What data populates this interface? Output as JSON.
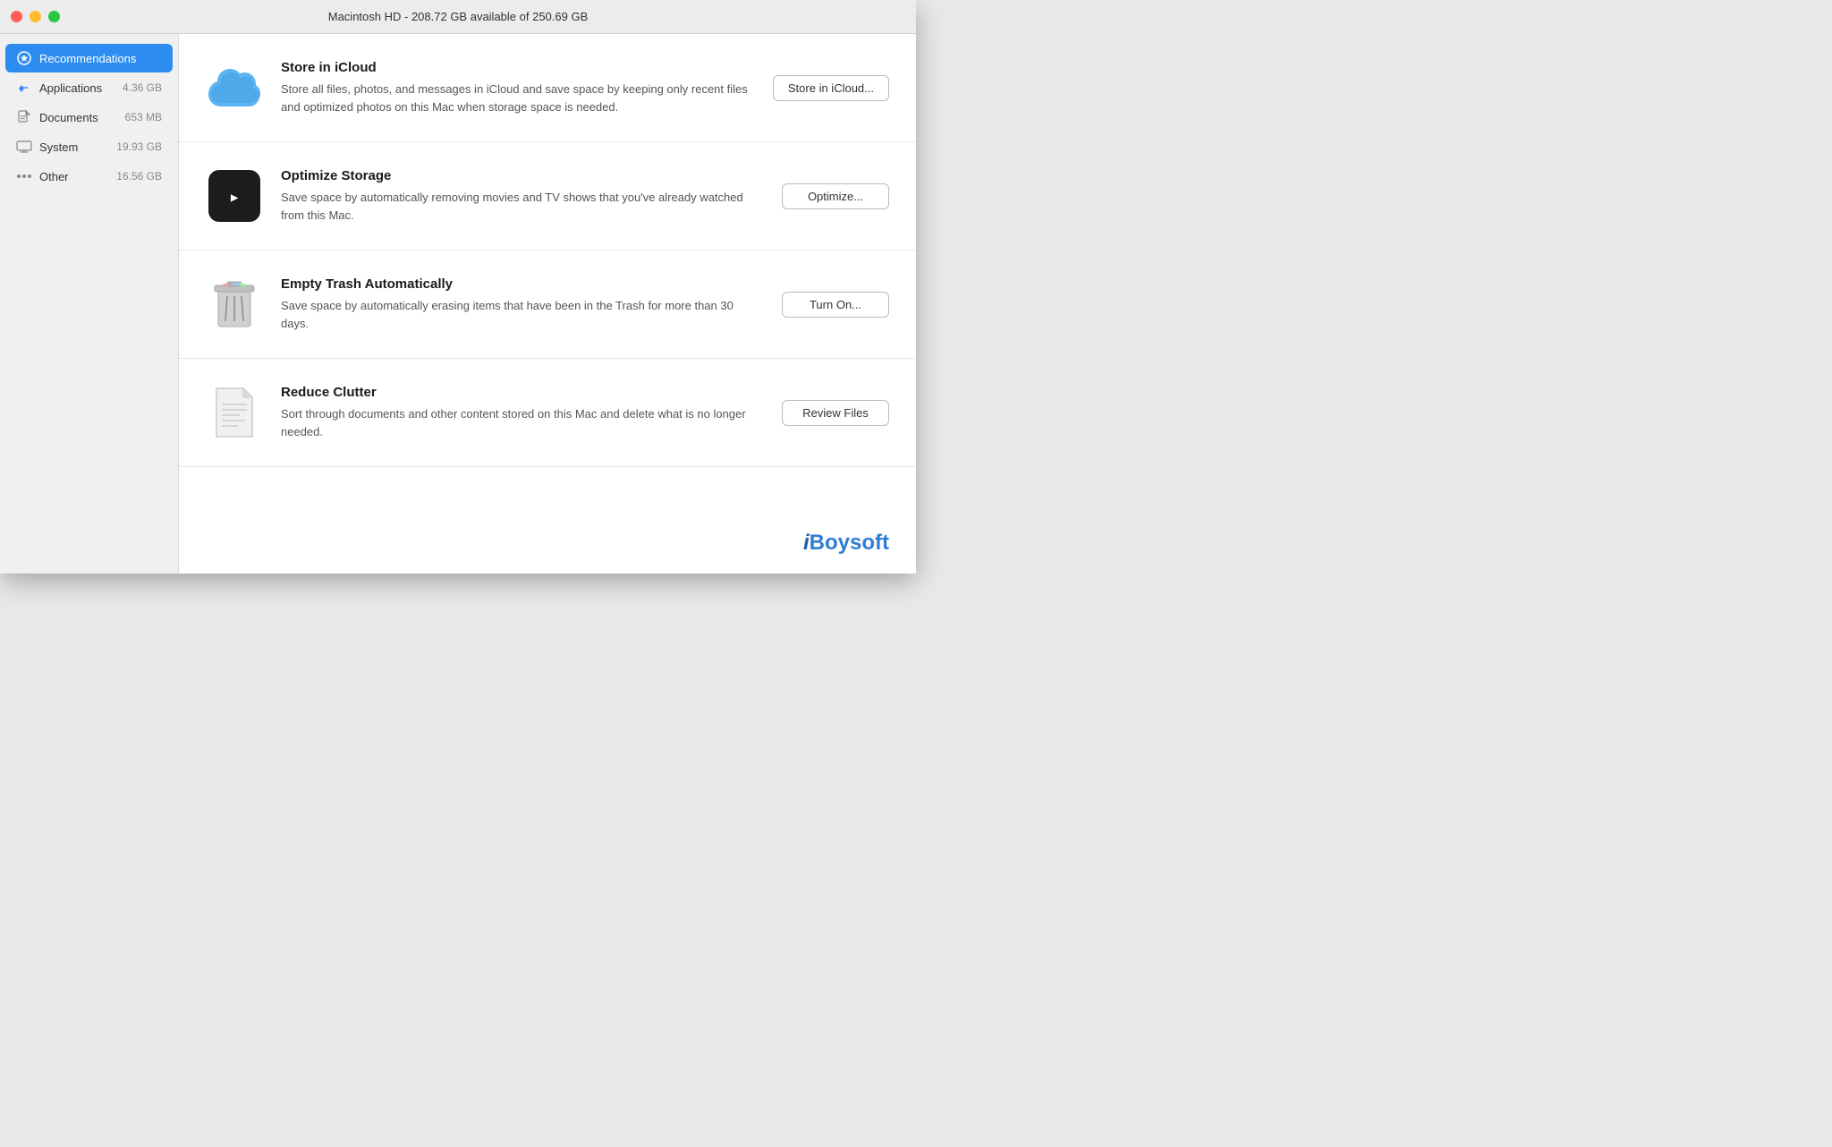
{
  "titlebar": {
    "title": "Macintosh HD - 208.72 GB available of 250.69 GB"
  },
  "sidebar": {
    "items": [
      {
        "id": "recommendations",
        "label": "Recommendations",
        "size": "",
        "active": true,
        "icon": "star"
      },
      {
        "id": "applications",
        "label": "Applications",
        "size": "4.36 GB",
        "active": false,
        "icon": "grid"
      },
      {
        "id": "documents",
        "label": "Documents",
        "size": "653 MB",
        "active": false,
        "icon": "doc"
      },
      {
        "id": "system",
        "label": "System",
        "size": "19.93 GB",
        "active": false,
        "icon": "laptop"
      },
      {
        "id": "other",
        "label": "Other",
        "size": "16.56 GB",
        "active": false,
        "icon": "dots"
      }
    ]
  },
  "recommendations": [
    {
      "id": "icloud",
      "title": "Store in iCloud",
      "description": "Store all files, photos, and messages in iCloud and save space by keeping only recent files and optimized photos on this Mac when storage space is needed.",
      "button_label": "Store in iCloud..."
    },
    {
      "id": "optimize",
      "title": "Optimize Storage",
      "description": "Save space by automatically removing movies and TV shows that you've already watched from this Mac.",
      "button_label": "Optimize..."
    },
    {
      "id": "trash",
      "title": "Empty Trash Automatically",
      "description": "Save space by automatically erasing items that have been in the Trash for more than 30 days.",
      "button_label": "Turn On..."
    },
    {
      "id": "clutter",
      "title": "Reduce Clutter",
      "description": "Sort through documents and other content stored on this Mac and delete what is no longer needed.",
      "button_label": "Review Files"
    }
  ],
  "watermark": {
    "text": "iBoysoft"
  }
}
